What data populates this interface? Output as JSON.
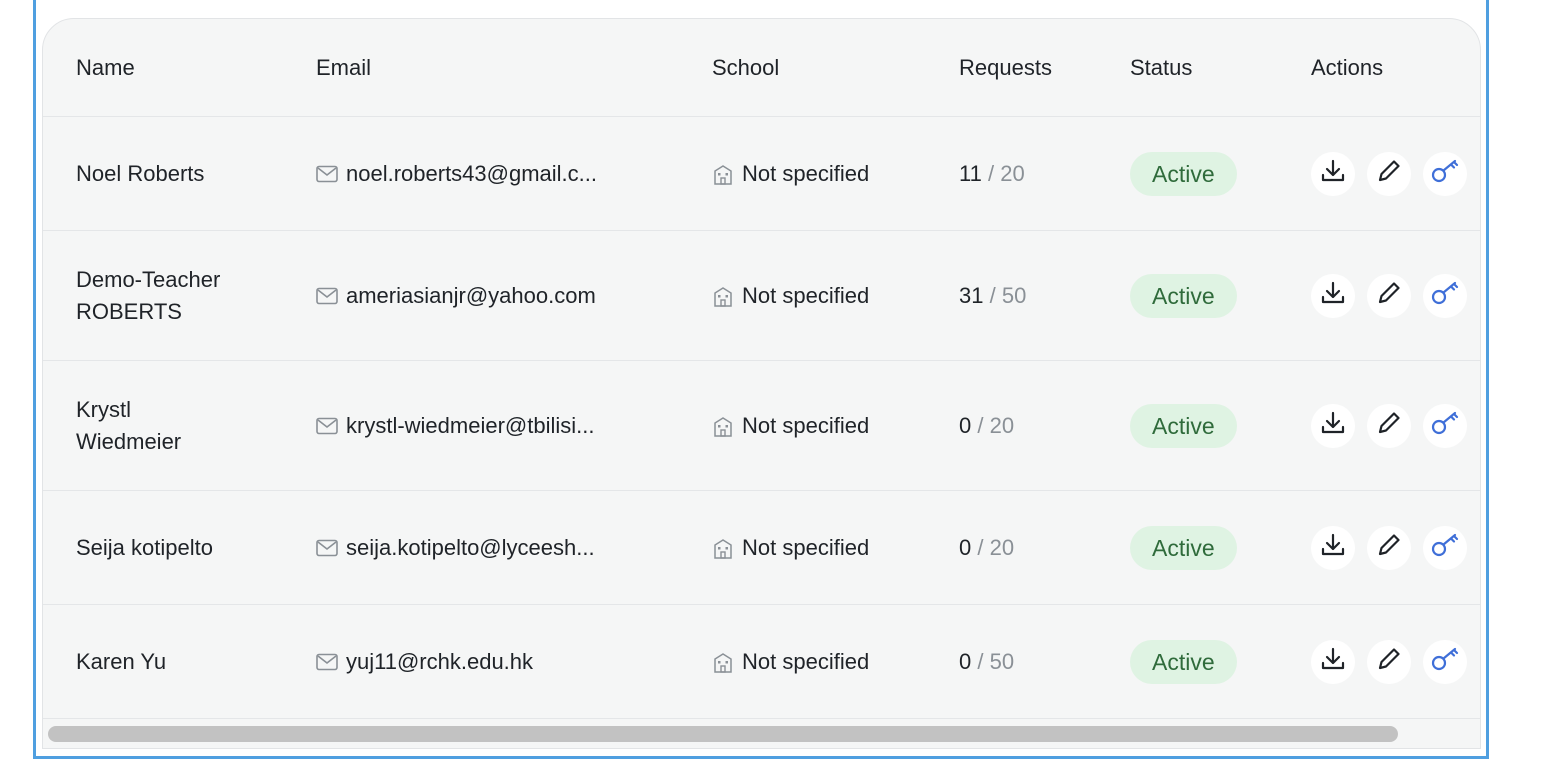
{
  "table": {
    "columns": {
      "name": "Name",
      "email": "Email",
      "school": "School",
      "requests": "Requests",
      "status": "Status",
      "actions": "Actions"
    },
    "rows": [
      {
        "name": "Noel Roberts",
        "email": "noel.roberts43@gmail.c...",
        "school": "Not specified",
        "requests_used": "11",
        "requests_sep": "/",
        "requests_total": "20",
        "status": "Active"
      },
      {
        "name": "Demo-Teacher ROBERTS",
        "email": "ameriasianjr@yahoo.com",
        "school": "Not specified",
        "requests_used": "31",
        "requests_sep": "/",
        "requests_total": "50",
        "status": "Active"
      },
      {
        "name": "Krystl Wiedmeier",
        "email": "krystl-wiedmeier@tbilisi...",
        "school": "Not specified",
        "requests_used": "0",
        "requests_sep": "/",
        "requests_total": "20",
        "status": "Active"
      },
      {
        "name": "Seija kotipelto",
        "email": "seija.kotipelto@lyceesh...",
        "school": "Not specified",
        "requests_used": "0",
        "requests_sep": "/",
        "requests_total": "20",
        "status": "Active"
      },
      {
        "name": "Karen Yu",
        "email": "yuj11@rchk.edu.hk",
        "school": "Not specified",
        "requests_used": "0",
        "requests_sep": "/",
        "requests_total": "50",
        "status": "Active"
      }
    ]
  },
  "icons": {
    "email": "mail-icon",
    "school": "building-icon",
    "download": "download-icon",
    "edit": "pencil-icon",
    "key": "key-icon"
  },
  "colors": {
    "status_bg": "#dff3e3",
    "status_text": "#2f6b3b",
    "key_icon": "#3f6fd8",
    "frame_border": "#4f9fe0"
  }
}
